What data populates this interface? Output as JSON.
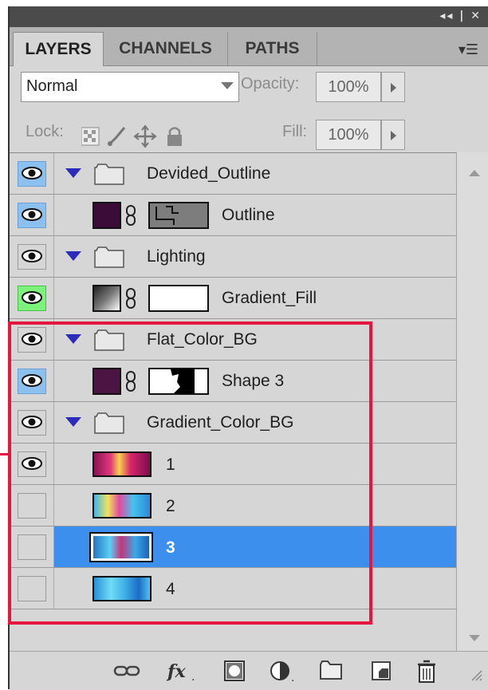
{
  "tabs": [
    "LAYERS",
    "CHANNELS",
    "PATHS"
  ],
  "blend_mode": "Normal",
  "opacity_label": "Opacity:",
  "opacity_value": "100%",
  "lock_label": "Lock:",
  "fill_label": "Fill:",
  "fill_value": "100%",
  "layers": [
    {
      "name": "Devided_Outline",
      "type": "group",
      "eye": "blue"
    },
    {
      "name": "Outline",
      "type": "shape",
      "eye": "blue"
    },
    {
      "name": "Lighting",
      "type": "group",
      "eye": "plain"
    },
    {
      "name": "Gradient_Fill",
      "type": "gradient",
      "eye": "green"
    },
    {
      "name": "Flat_Color_BG",
      "type": "group",
      "eye": "plain"
    },
    {
      "name": "Shape 3",
      "type": "shape",
      "eye": "blue"
    },
    {
      "name": "Gradient_Color_BG",
      "type": "group",
      "eye": "plain"
    },
    {
      "name": "1",
      "type": "image",
      "eye": "plain"
    },
    {
      "name": "2",
      "type": "image",
      "eye": "hidden"
    },
    {
      "name": "3",
      "type": "image",
      "eye": "hidden",
      "selected": true
    },
    {
      "name": "4",
      "type": "image",
      "eye": "hidden"
    }
  ],
  "colors": {
    "selection": "#3d8fed",
    "highlight_outline": "#e5173e",
    "shape_fill": "#3a0c37"
  }
}
